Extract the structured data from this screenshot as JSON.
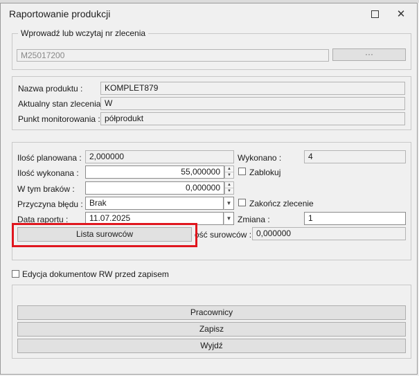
{
  "window": {
    "title": "Raportowanie produkcji",
    "maximize_icon": "maximize-icon",
    "close_glyph": "✕"
  },
  "order": {
    "legend": "Wprowadź lub wczytaj nr zlecenia",
    "value": "M25017200",
    "browse_label": "···"
  },
  "product": {
    "name_label": "Nazwa produktu :",
    "name_value": "KOMPLET879",
    "state_label": "Aktualny stan zlecenia :",
    "state_value": "W",
    "point_label": "Punkt monitorowania :",
    "point_value": "półprodukt"
  },
  "production": {
    "planned_label": "Ilość planowana :",
    "planned_value": "2,000000",
    "done_label": "Wykonano :",
    "done_value": "4",
    "made_label": "Ilość wykonana :",
    "made_value": "55,000000",
    "lock_label": "Zablokuj",
    "scrap_label": "W tym braków  :",
    "scrap_value": "0,000000",
    "error_label": "Przyczyna błędu :",
    "error_value": "Brak",
    "close_order_label": "Zakończ zlecenie",
    "date_label": "Data raportu   :",
    "date_value": "11.07.2025",
    "shift_label": "Zmiana    :",
    "shift_value": "1",
    "materials_button": "Lista surowców",
    "materials_qty_label": "ość surowców :",
    "materials_qty_value": "0,000000"
  },
  "rw_edit_label": "Edycja dokumentow RW przed zapisem",
  "actions": {
    "workers": "Pracownicy",
    "save": "Zapisz",
    "exit": "Wyjdź"
  },
  "colors": {
    "highlight": "#e0161e",
    "background": "#f0f0f0"
  }
}
